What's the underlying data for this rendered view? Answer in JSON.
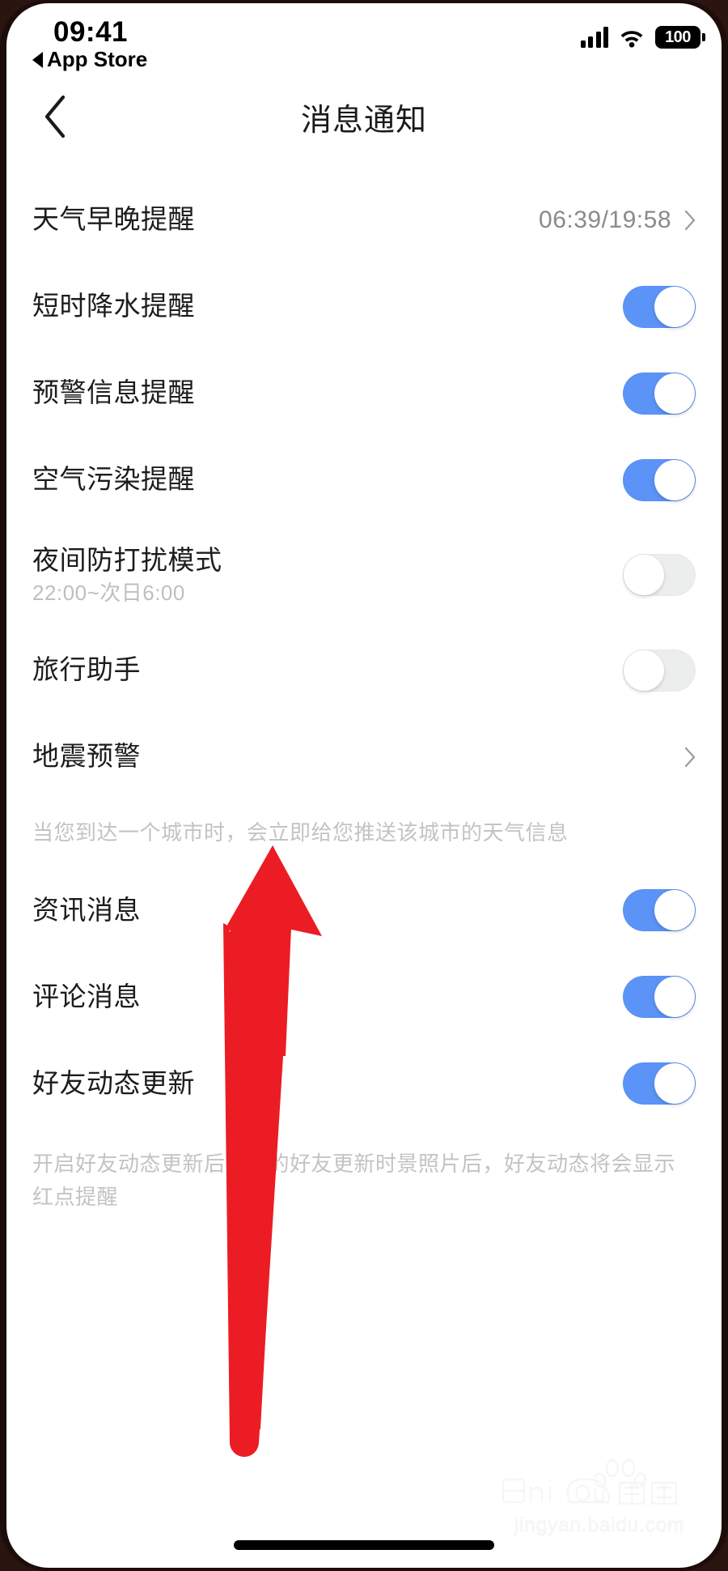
{
  "status_bar": {
    "time": "09:41",
    "back_app": "App Store",
    "signal_icon": "cellular-signal-icon",
    "wifi_icon": "wifi-icon",
    "battery_level": "100"
  },
  "nav": {
    "back_icon": "chevron-left-icon",
    "title": "消息通知"
  },
  "settings": {
    "rows": [
      {
        "title": "天气早晚提醒",
        "value": "06:39/19:58",
        "control": "chevron"
      },
      {
        "title": "短时降水提醒",
        "control": "toggle",
        "on": true
      },
      {
        "title": "预警信息提醒",
        "control": "toggle",
        "on": true
      },
      {
        "title": "空气污染提醒",
        "control": "toggle",
        "on": true
      },
      {
        "title": "夜间防打扰模式",
        "sub": "22:00~次日6:00",
        "control": "toggle",
        "on": false
      },
      {
        "title": "旅行助手",
        "control": "toggle",
        "on": false
      },
      {
        "title": "地震预警",
        "control": "chevron"
      }
    ],
    "note_travel": "当您到达一个城市时，会立即给您推送该城市的天气信息",
    "rows2": [
      {
        "title": "资讯消息",
        "control": "toggle",
        "on": true
      },
      {
        "title": "评论消息",
        "control": "toggle",
        "on": true
      },
      {
        "title": "好友动态更新",
        "control": "toggle",
        "on": true
      }
    ],
    "note_friends": "开启好友动态更新后，您的好友更新时景照片后，好友动态将会显示红点提醒"
  },
  "annotation": {
    "arrow_icon": "red-up-arrow-annotation",
    "color": "#ec1c24"
  },
  "watermark": {
    "logo_text": "Bai",
    "logo_text2": "du",
    "logo_cn": "经验",
    "url": "jingyan.baidu.com"
  },
  "colors": {
    "toggle_on": "#5b93f7",
    "toggle_off": "#eceded",
    "title_text": "#1c1c1c",
    "muted_text": "#c3c3c3"
  }
}
